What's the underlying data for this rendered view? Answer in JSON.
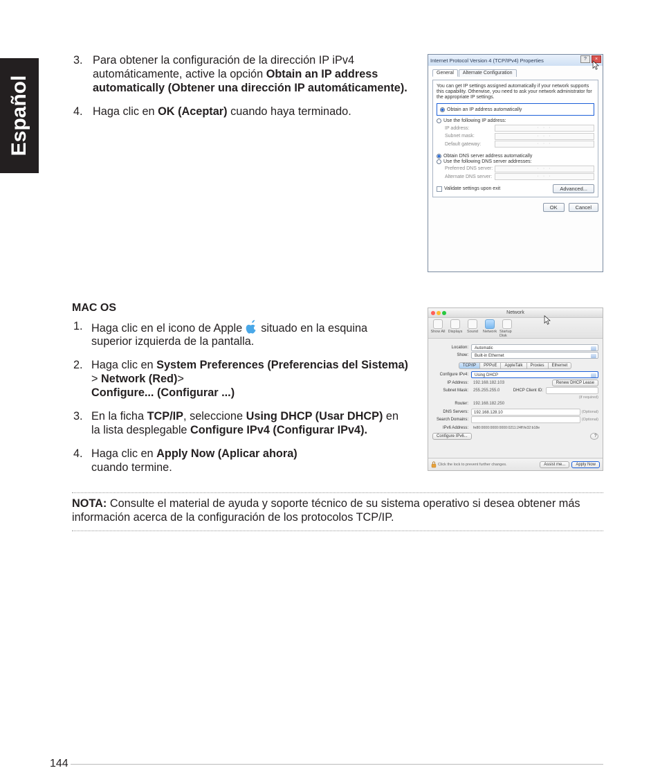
{
  "lang_tab": "Español",
  "page_number": "144",
  "windows_steps": {
    "s3_a": "Para obtener la configuración de la dirección IP iPv4 automáticamente, active la opción ",
    "s3_b": "Obtain an IP address automatically (Obtener una dirección IP automáticamente).",
    "s4_a": "Haga clic en ",
    "s4_b": "OK (Aceptar)",
    "s4_c": " cuando haya terminado."
  },
  "mac_heading": "MAC OS",
  "mac_steps": {
    "s1_a": "Haga clic en el icono de Apple ",
    "s1_b": " situado en la es­quina superior izquierda de la pantalla.",
    "s2_a": "Haga clic en ",
    "s2_b": "System Preferences (Preferencias del Sistema)",
    "s2_gt1": " > ",
    "s2_c": "Network (Red)",
    "s2_gt2": "> ",
    "s2_d": "Configure... (Configurar ...)",
    "s3_a": "En la ficha ",
    "s3_b": "TCP/IP",
    "s3_c": ", seleccione ",
    "s3_d": "Using DHCP (Usar DHCP)",
    "s3_e": " en la lista desplegable ",
    "s3_f": "Configure IPv4 (Con­figurar IPv4).",
    "s4_a": "Haga clic en ",
    "s4_b": "Apply Now (Aplicar ahora)",
    "s4_c": " cuando termine."
  },
  "note": {
    "label": "NOTA:",
    "text": " Consulte el material de ayuda y soporte técnico de su sistema operativo si de­sea obtener más información acerca de la configuración de los protocolos TCP/IP."
  },
  "win_dialog": {
    "title": "Internet Protocol Version 4 (TCP/IPv4) Properties",
    "tab_general": "General",
    "tab_alt": "Alternate Configuration",
    "desc": "You can get IP settings assigned automatically if your network supports this capability. Otherwise, you need to ask your network administrator for the appropriate IP settings.",
    "r_obtain_ip": "Obtain an IP address automatically",
    "r_use_ip": "Use the following IP address:",
    "lbl_ip": "IP address:",
    "lbl_subnet": "Subnet mask:",
    "lbl_gateway": "Default gateway:",
    "r_obtain_dns": "Obtain DNS server address automatically",
    "r_use_dns": "Use the following DNS server addresses:",
    "lbl_pref_dns": "Preferred DNS server:",
    "lbl_alt_dns": "Alternate DNS server:",
    "chk_validate": "Validate settings upon exit",
    "btn_advanced": "Advanced...",
    "btn_ok": "OK",
    "btn_cancel": "Cancel"
  },
  "mac_window": {
    "title": "Network",
    "toolbar": {
      "showall": "Show All",
      "displays": "Displays",
      "sound": "Sound",
      "network": "Network",
      "startup": "Startup Disk"
    },
    "lbl_location": "Location:",
    "val_location": "Automatic",
    "lbl_show": "Show:",
    "val_show": "Built-in Ethernet",
    "tabs": {
      "tcpip": "TCP/IP",
      "pppoe": "PPPoE",
      "appletalk": "AppleTalk",
      "proxies": "Proxies",
      "ethernet": "Ethernet"
    },
    "lbl_conf": "Configure IPv4:",
    "val_conf": "Using DHCP",
    "lbl_ipaddr": "IP Address:",
    "val_ipaddr": "192.168.182.103",
    "btn_renew": "Renew DHCP Lease",
    "lbl_subnet": "Subnet Mask:",
    "val_subnet": "255.255.255.0",
    "lbl_client": "DHCP Client ID:",
    "hint_client": "(if required)",
    "lbl_router": "Router:",
    "val_router": "192.168.182.250",
    "lbl_dns": "DNS Servers:",
    "val_dns": "192.168.128.10",
    "hint_optional": "(Optional)",
    "lbl_search": "Search Domains:",
    "lbl_ipv6": "IPv6 Address:",
    "val_ipv6": "fe80:0000:0000:0000:0211:24ff:fe32:b18e",
    "btn_conf6": "Configure IPv6...",
    "lock_text": "Click the lock to prevent further changes.",
    "btn_assist": "Assist me...",
    "btn_apply": "Apply Now",
    "help": "?"
  }
}
